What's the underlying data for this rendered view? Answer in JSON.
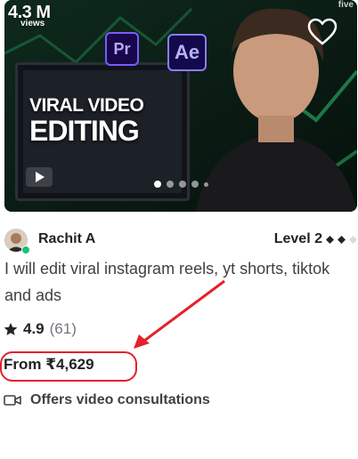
{
  "thumbnail": {
    "views_count": "4.3 M",
    "views_label": "views",
    "brand_mark": "five",
    "overlay_line1": "VIRAL VIDEO",
    "overlay_line2": "EDITING",
    "app_icon_1": "Pr",
    "app_icon_2": "Ae",
    "carousel_dots": 5,
    "active_dot": 0,
    "icons": [
      "heart-icon",
      "play-icon"
    ]
  },
  "seller": {
    "name": "Rachit A",
    "level": "Level 2",
    "level_diamonds_filled": 2,
    "level_diamonds_total": 3,
    "online": true
  },
  "gig": {
    "title": "I will edit viral instagram reels, yt shorts, tiktok and ads",
    "rating": "4.9",
    "reviews": "(61)",
    "price": "From ₹4,629",
    "consultation": "Offers video consultations"
  },
  "colors": {
    "accent_green": "#1dbf73",
    "annotation_red": "#e5202a",
    "text_dark": "#222325",
    "text_body": "#404145"
  }
}
